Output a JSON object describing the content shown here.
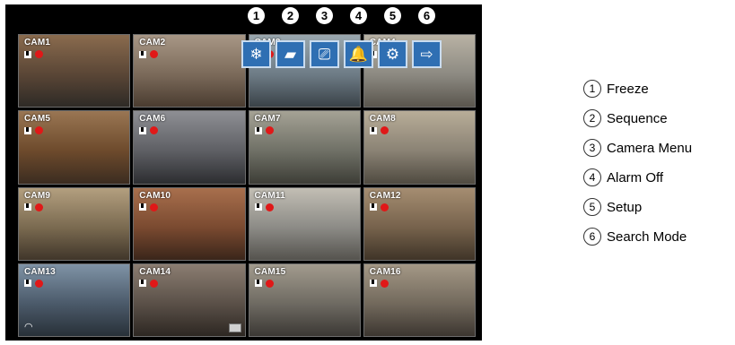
{
  "cameras": [
    {
      "label": "CAM1"
    },
    {
      "label": "CAM2"
    },
    {
      "label": "CAM3"
    },
    {
      "label": "CAM4"
    },
    {
      "label": "CAM5"
    },
    {
      "label": "CAM6"
    },
    {
      "label": "CAM7"
    },
    {
      "label": "CAM8"
    },
    {
      "label": "CAM9"
    },
    {
      "label": "CAM10"
    },
    {
      "label": "CAM11"
    },
    {
      "label": "CAM12"
    },
    {
      "label": "CAM13"
    },
    {
      "label": "CAM14"
    },
    {
      "label": "CAM15"
    },
    {
      "label": "CAM16"
    }
  ],
  "toolbar": {
    "buttons": [
      {
        "number": "1",
        "icon": "freeze-icon",
        "glyph": "❄"
      },
      {
        "number": "2",
        "icon": "sequence-icon",
        "glyph": "▰"
      },
      {
        "number": "3",
        "icon": "camera-menu-icon",
        "glyph": "⎚"
      },
      {
        "number": "4",
        "icon": "alarm-bell-icon",
        "glyph": "🔔"
      },
      {
        "number": "5",
        "icon": "setup-gear-icon",
        "glyph": "⚙"
      },
      {
        "number": "6",
        "icon": "search-mode-icon",
        "glyph": "⇨"
      }
    ]
  },
  "legend": [
    {
      "number": "1",
      "text": "Freeze"
    },
    {
      "number": "2",
      "text": "Sequence"
    },
    {
      "number": "3",
      "text": "Camera Menu"
    },
    {
      "number": "4",
      "text": "Alarm Off"
    },
    {
      "number": "5",
      "text": "Setup"
    },
    {
      "number": "6",
      "text": "Search Mode"
    }
  ],
  "colors": {
    "toolbar_button": "#2f6fb3",
    "record_dot": "#e01818",
    "screen_bg": "#000000"
  }
}
